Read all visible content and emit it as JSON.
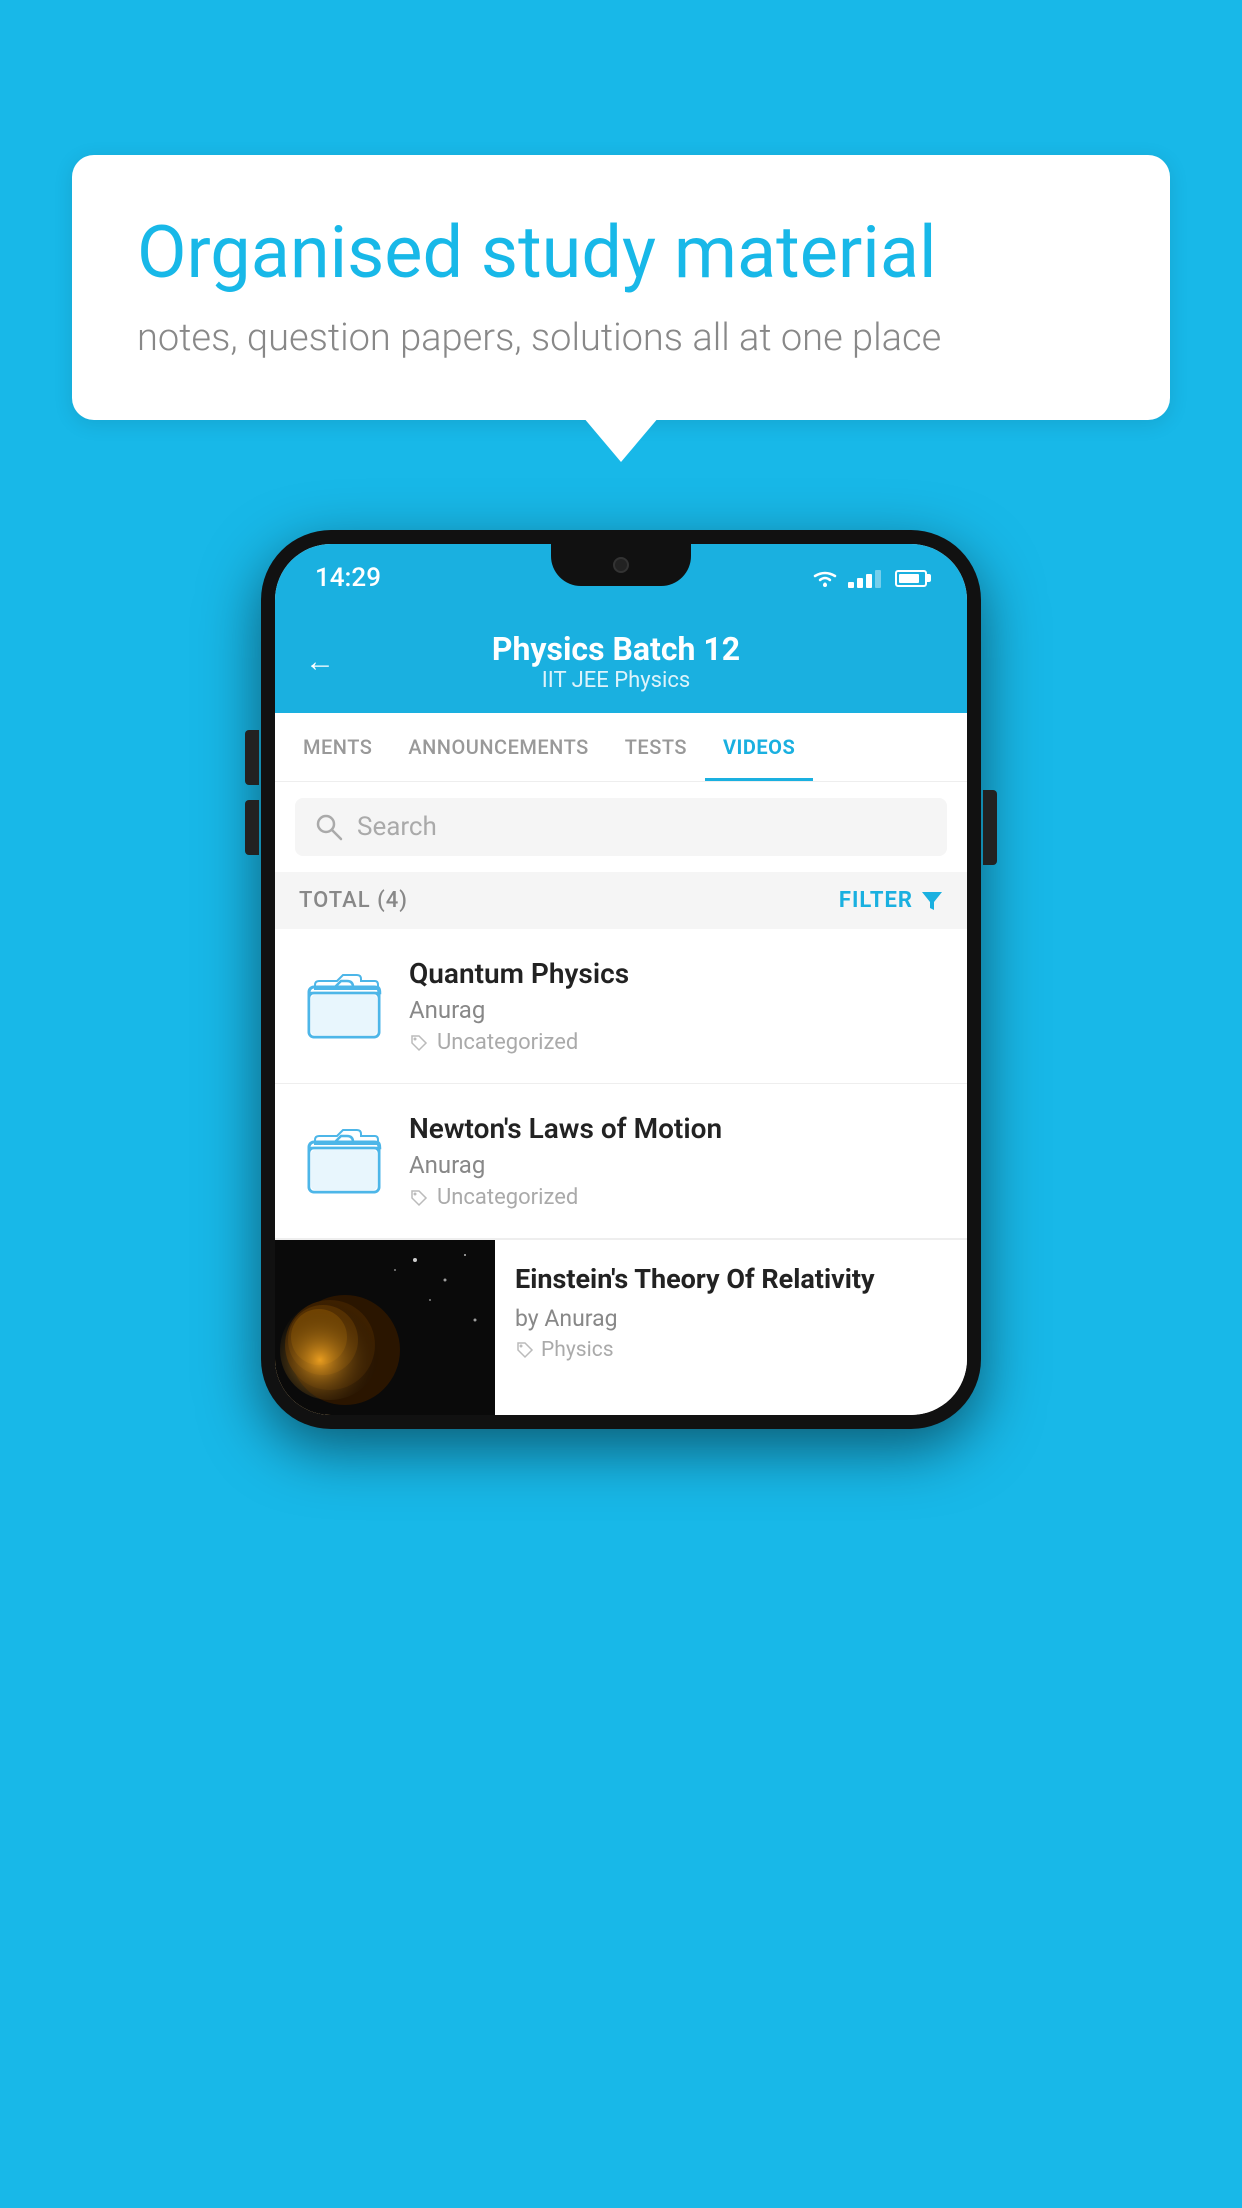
{
  "background": {
    "color": "#18b8e8"
  },
  "speech_bubble": {
    "heading": "Organised study material",
    "subtext": "notes, question papers, solutions all at one place"
  },
  "phone": {
    "status_bar": {
      "time": "14:29"
    },
    "header": {
      "title": "Physics Batch 12",
      "subtitle": "IIT JEE   Physics",
      "back_label": "←"
    },
    "tabs": [
      {
        "label": "MENTS",
        "active": false
      },
      {
        "label": "ANNOUNCEMENTS",
        "active": false
      },
      {
        "label": "TESTS",
        "active": false
      },
      {
        "label": "VIDEOS",
        "active": true
      }
    ],
    "search": {
      "placeholder": "Search"
    },
    "filter": {
      "total_label": "TOTAL (4)",
      "filter_label": "FILTER"
    },
    "videos": [
      {
        "id": 1,
        "title": "Quantum Physics",
        "author": "Anurag",
        "tag": "Uncategorized",
        "type": "folder"
      },
      {
        "id": 2,
        "title": "Newton's Laws of Motion",
        "author": "Anurag",
        "tag": "Uncategorized",
        "type": "folder"
      },
      {
        "id": 3,
        "title": "Einstein's Theory Of Relativity",
        "author": "by Anurag",
        "tag": "Physics",
        "type": "video"
      }
    ]
  }
}
